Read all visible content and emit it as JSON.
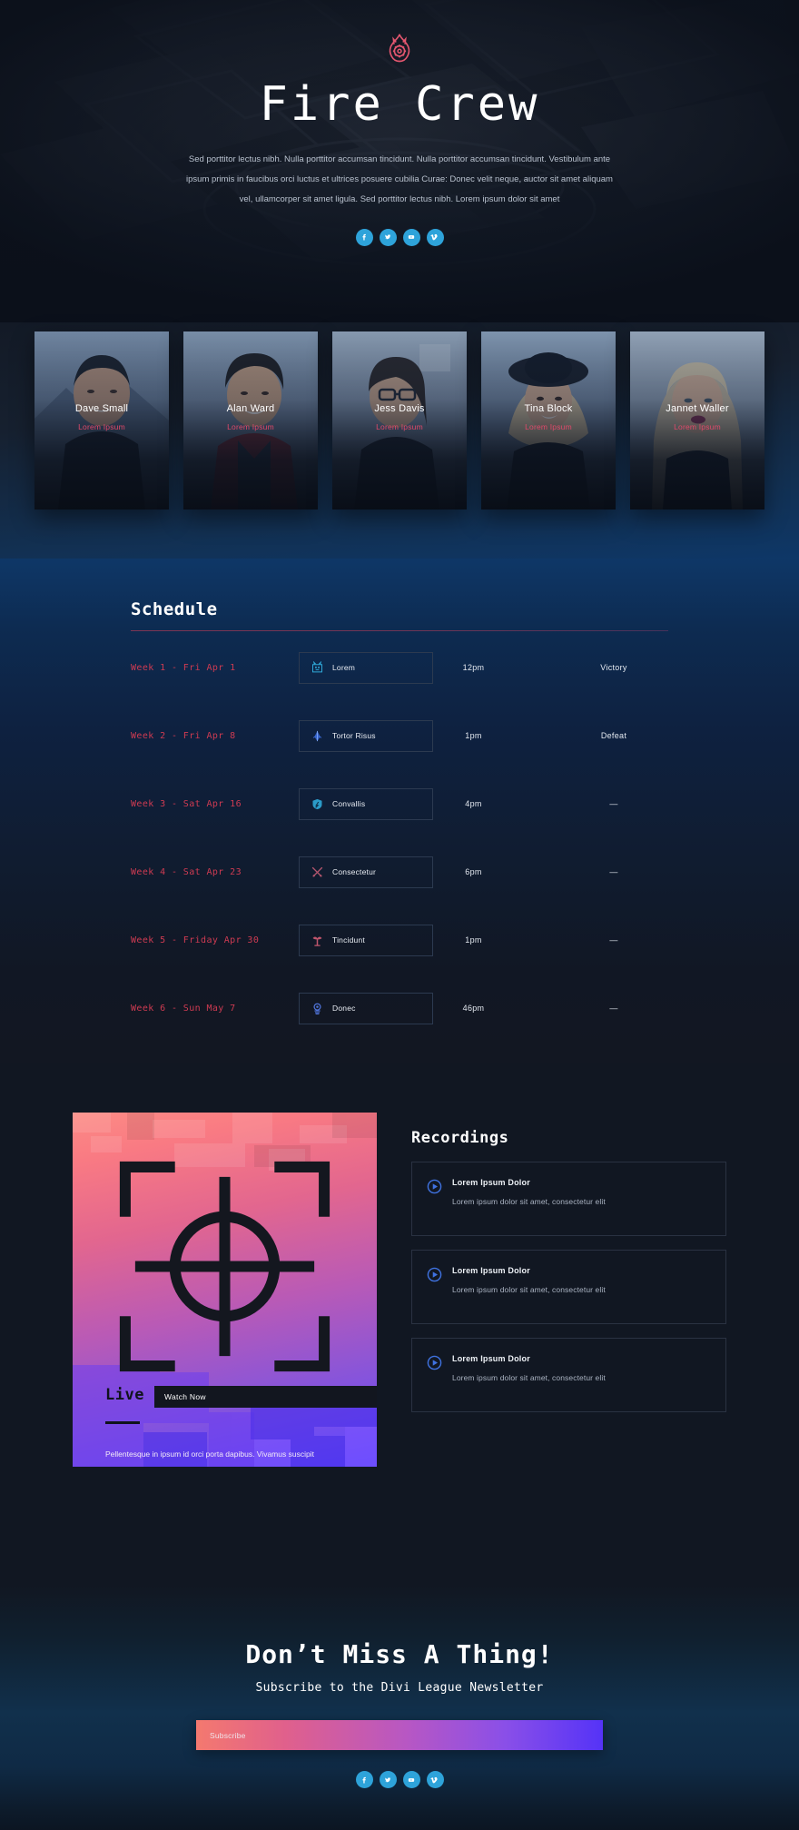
{
  "hero": {
    "logo_icon": "fire-gear-logo",
    "title": "Fire Crew",
    "paragraph": "Sed porttitor lectus nibh. Nulla porttitor accumsan tincidunt. Nulla porttitor accumsan tincidunt. Vestibulum ante ipsum primis in faucibus orci luctus et ultrices posuere cubilia Curae: Donec velit neque, auctor sit amet aliquam vel, ullamcorper sit amet ligula. Sed porttitor lectus nibh. Lorem ipsum dolor sit amet",
    "socials": [
      {
        "name": "facebook-icon",
        "label": "Facebook"
      },
      {
        "name": "twitter-icon",
        "label": "Twitter"
      },
      {
        "name": "youtube-icon",
        "label": "YouTube"
      },
      {
        "name": "vimeo-icon",
        "label": "Vimeo"
      }
    ]
  },
  "team": {
    "members": [
      {
        "name": "Dave Small",
        "role": "Lorem Ipsum"
      },
      {
        "name": "Alan Ward",
        "role": "Lorem Ipsum"
      },
      {
        "name": "Jess Davis",
        "role": "Lorem Ipsum"
      },
      {
        "name": "Tina Block",
        "role": "Lorem Ipsum"
      },
      {
        "name": "Jannet Waller",
        "role": "Lorem Ipsum"
      }
    ]
  },
  "schedule": {
    "title": "Schedule",
    "rows": [
      {
        "week": "Week 1 - Fri Apr 1",
        "game": "Lorem",
        "icon": "game-icon-lorem",
        "time": "12pm",
        "result": "Victory"
      },
      {
        "week": "Week 2 - Fri Apr 8",
        "game": "Tortor Risus",
        "icon": "game-icon-tortor",
        "time": "1pm",
        "result": "Defeat"
      },
      {
        "week": "Week 3 - Sat Apr 16",
        "game": "Convallis",
        "icon": "game-icon-convallis",
        "time": "4pm",
        "result": "—"
      },
      {
        "week": "Week 4 - Sat Apr 23",
        "game": "Consectetur",
        "icon": "game-icon-consectetur",
        "time": "6pm",
        "result": "—"
      },
      {
        "week": "Week 5 - Friday Apr 30",
        "game": "Tincidunt",
        "icon": "game-icon-tincidunt",
        "time": "1pm",
        "result": "—"
      },
      {
        "week": "Week 6 - Sun May 7",
        "game": "Donec",
        "icon": "game-icon-donec",
        "time": "46pm",
        "result": "—"
      }
    ]
  },
  "stream": {
    "icon": "crosshair-target-icon",
    "title": "Live Stream",
    "paragraph": "Pellentesque in ipsum id orci porta dapibus. Vivamus suscipit tortor eget felis porttitor volutpat. Proin eget tortor risus. Viva",
    "watch_label": "Watch Now"
  },
  "recordings": {
    "title": "Recordings",
    "items": [
      {
        "heading": "Lorem Ipsum Dolor",
        "desc": "Lorem ipsum dolor sit amet, consectetur  elit"
      },
      {
        "heading": "Lorem Ipsum Dolor",
        "desc": "Lorem ipsum dolor sit amet, consectetur  elit"
      },
      {
        "heading": "Lorem Ipsum Dolor",
        "desc": "Lorem ipsum dolor sit amet, consectetur  elit"
      }
    ]
  },
  "newsletter": {
    "heading": "Don’t Miss A Thing!",
    "subheading": "Subscribe to the Divi League Newsletter",
    "placeholder": "Subscribe",
    "value": "",
    "socials": [
      {
        "name": "facebook-icon",
        "label": "Facebook"
      },
      {
        "name": "twitter-icon",
        "label": "Twitter"
      },
      {
        "name": "youtube-icon",
        "label": "YouTube"
      },
      {
        "name": "vimeo-icon",
        "label": "Vimeo"
      }
    ]
  },
  "colors": {
    "accent_red": "#cf3b52",
    "accent_blue": "#2ea3da",
    "gradient_start": "#f4796f",
    "gradient_end": "#5533f7",
    "dark_bg": "#111722"
  }
}
